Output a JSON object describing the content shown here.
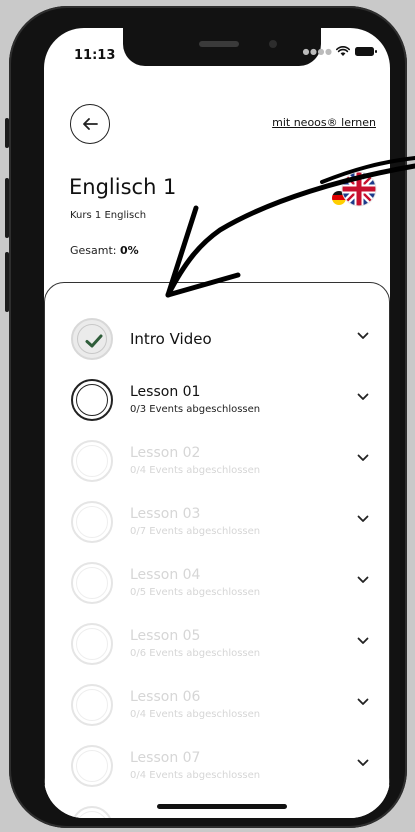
{
  "status_bar": {
    "time": "11:13"
  },
  "header": {
    "learn_link": "mit neoos® lernen",
    "course_title": "Englisch 1",
    "course_subtitle": "Kurs 1 Englisch",
    "total_label": "Gesamt:",
    "total_value": "0%"
  },
  "lessons": [
    {
      "title": "Intro Video",
      "subtitle": "",
      "state": "done"
    },
    {
      "title": "Lesson 01",
      "subtitle": "0/3 Events abgeschlossen",
      "state": "active"
    },
    {
      "title": "Lesson 02",
      "subtitle": "0/4 Events abgeschlossen",
      "state": "locked"
    },
    {
      "title": "Lesson 03",
      "subtitle": "0/7 Events abgeschlossen",
      "state": "locked"
    },
    {
      "title": "Lesson 04",
      "subtitle": "0/5 Events abgeschlossen",
      "state": "locked"
    },
    {
      "title": "Lesson 05",
      "subtitle": "0/6 Events abgeschlossen",
      "state": "locked"
    },
    {
      "title": "Lesson 06",
      "subtitle": "0/4 Events abgeschlossen",
      "state": "locked"
    },
    {
      "title": "Lesson 07",
      "subtitle": "0/4 Events abgeschlossen",
      "state": "locked"
    }
  ],
  "icons": {
    "back": "arrow-left-icon",
    "chevron": "chevron-down-icon",
    "check": "check-icon",
    "flags": [
      "uk-flag-icon",
      "german-flag-icon"
    ]
  },
  "colors": {
    "check_green": "#2f5d3a",
    "locked_text": "#d6d6d6",
    "frame": "#121212"
  }
}
